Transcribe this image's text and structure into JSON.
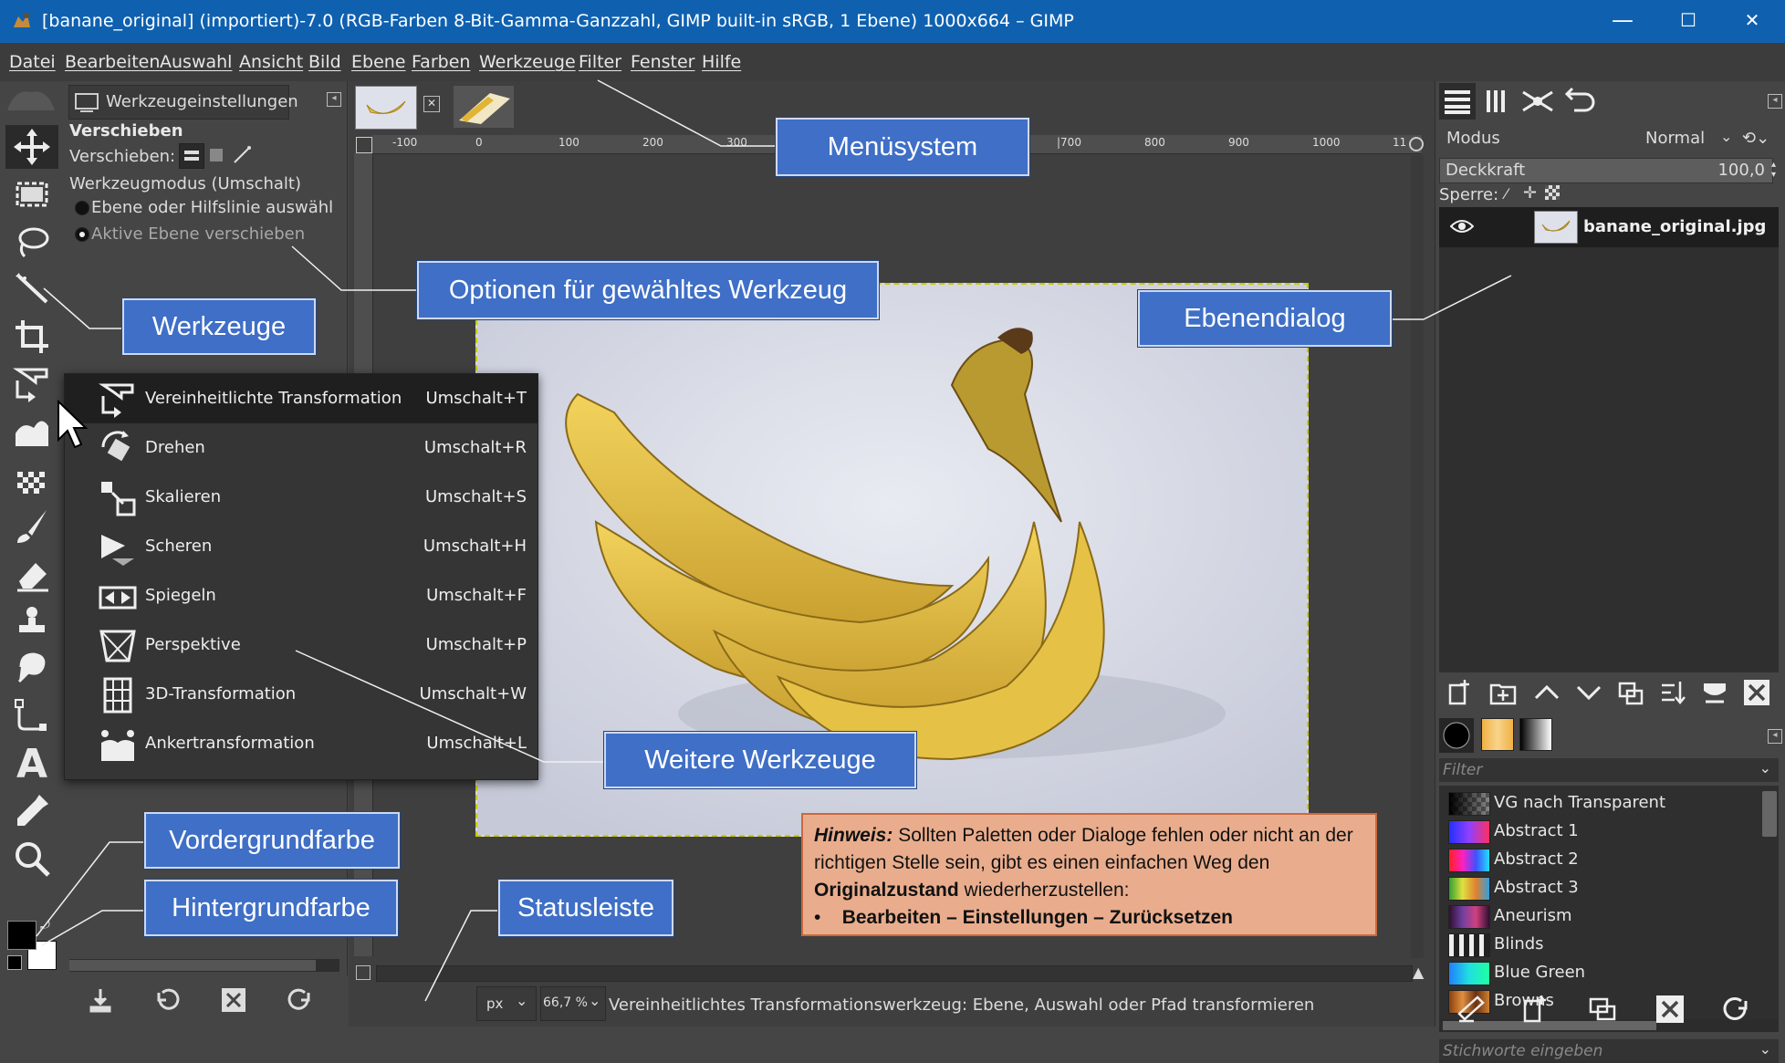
{
  "window": {
    "title": "[banane_original] (importiert)-7.0 (RGB-Farben 8-Bit-Gamma-Ganzzahl, GIMP built-in sRGB, 1 Ebene) 1000x664 – GIMP",
    "minimize": "—",
    "maximize": "☐",
    "close": "✕"
  },
  "menubar": [
    "Datei",
    "Bearbeiten",
    "Auswahl",
    "Ansicht",
    "Bild",
    "Ebene",
    "Farben",
    "Werkzeuge",
    "Filter",
    "Fenster",
    "Hilfe"
  ],
  "tool_options": {
    "tab_label": "Werkzeugeinstellungen",
    "tool_name": "Verschieben",
    "move_label": "Verschieben:",
    "mode_label": "Werkzeugmodus (Umschalt)",
    "radio_1": "Ebene oder Hilfslinie auswähl",
    "radio_2": "Aktive Ebene verschieben"
  },
  "ruler_labels": [
    "-100",
    "0",
    "100",
    "200",
    "300",
    "|700",
    "800",
    "900",
    "1000",
    "11"
  ],
  "transform_menu": [
    {
      "label": "Vereinheitlichte Transformation",
      "shortcut": "Umschalt+T",
      "icon": "unified-transform-icon"
    },
    {
      "label": "Drehen",
      "shortcut": "Umschalt+R",
      "icon": "rotate-icon"
    },
    {
      "label": "Skalieren",
      "shortcut": "Umschalt+S",
      "icon": "scale-icon"
    },
    {
      "label": "Scheren",
      "shortcut": "Umschalt+H",
      "icon": "shear-icon"
    },
    {
      "label": "Spiegeln",
      "shortcut": "Umschalt+F",
      "icon": "flip-icon"
    },
    {
      "label": "Perspektive",
      "shortcut": "Umschalt+P",
      "icon": "perspective-icon"
    },
    {
      "label": "3D-Transformation",
      "shortcut": "Umschalt+W",
      "icon": "3d-transform-icon"
    },
    {
      "label": "Ankertransformation",
      "shortcut": "Umschalt+L",
      "icon": "handle-transform-icon"
    }
  ],
  "layers": {
    "mode_label": "Modus",
    "mode_value": "Normal",
    "opacity_label": "Deckkraft",
    "opacity_value": "100,0",
    "lock_label": "Sperre:",
    "layer_name": "banane_original.jpg"
  },
  "gradients": {
    "filter_placeholder": "Filter",
    "tags_placeholder": "Stichworte eingeben",
    "items": [
      {
        "name": "VG nach Transparent"
      },
      {
        "name": "Abstract 1"
      },
      {
        "name": "Abstract 2"
      },
      {
        "name": "Abstract 3"
      },
      {
        "name": "Aneurism"
      },
      {
        "name": "Blinds"
      },
      {
        "name": "Blue Green"
      },
      {
        "name": "Browns"
      }
    ]
  },
  "statusbar": {
    "unit": "px",
    "zoom": "66,7 %",
    "message": "Vereinheitlichtes Transformationswerkzeug: Ebene, Auswahl oder Pfad transformieren"
  },
  "callouts": {
    "menu": "Menüsystem",
    "options": "Optionen für gewähltes Werkzeug",
    "tools": "Werkzeuge",
    "layers": "Ebenendialog",
    "more_tools": "Weitere Werkzeuge",
    "fg": "Vordergrundfarbe",
    "bg": "Hintergrundfarbe",
    "status": "Statusleiste"
  },
  "hint": {
    "label": "Hinweis:",
    "text1": " Sollten Paletten oder Dialoge fehlen oder nicht an der richtigen Stelle sein, gibt es einen einfachen Weg den ",
    "bold": "Originalzustand",
    "text2": " wiederherzustellen:",
    "bullet": "Bearbeiten – Einstellungen – Zurücksetzen"
  },
  "colors": {
    "titlebar": "#0f61b0",
    "callout": "#3f6fc6",
    "hint_bg": "#e9ad8d",
    "selection": "#c9c900"
  }
}
